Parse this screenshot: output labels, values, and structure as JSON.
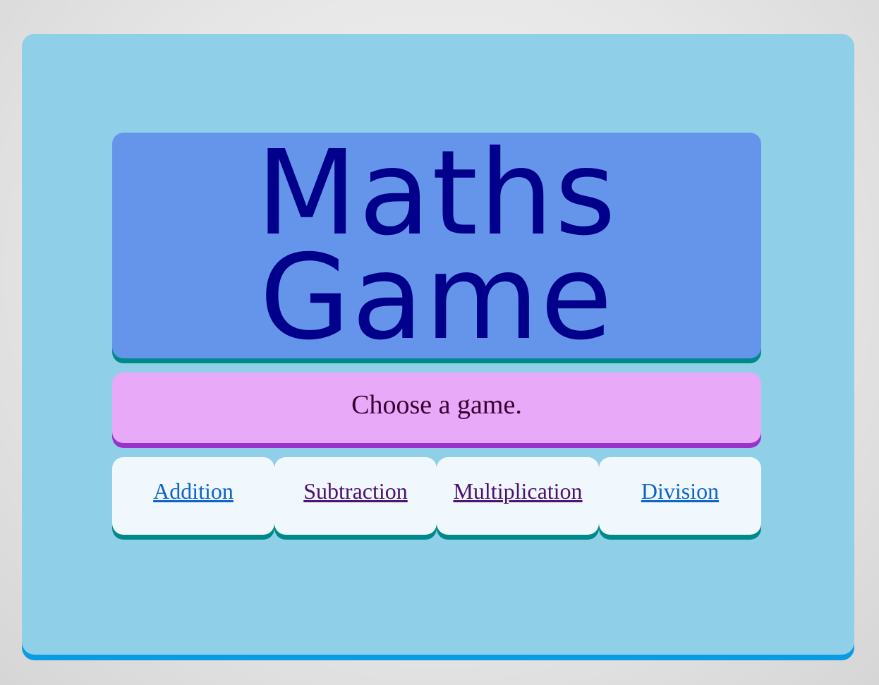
{
  "title": {
    "line1": "Maths",
    "line2": "Game"
  },
  "prompt": "Choose a game.",
  "games": [
    {
      "label": "Addition",
      "visited": false
    },
    {
      "label": "Subtraction",
      "visited": true
    },
    {
      "label": "Multiplication",
      "visited": true
    },
    {
      "label": "Division",
      "visited": false
    }
  ],
  "colors": {
    "page_background": "#e6e6e6",
    "panel": "#8fd0e8",
    "panel_shadow": "#0a9be3",
    "title_box": "#6595ea",
    "title_text": "#00008b",
    "accent_shadow": "#00898a",
    "prompt_box": "#e7a9f8",
    "prompt_shadow": "#9932cc",
    "card": "#f0f8fe",
    "link": "#0d64c8",
    "link_visited": "#4b1270"
  }
}
